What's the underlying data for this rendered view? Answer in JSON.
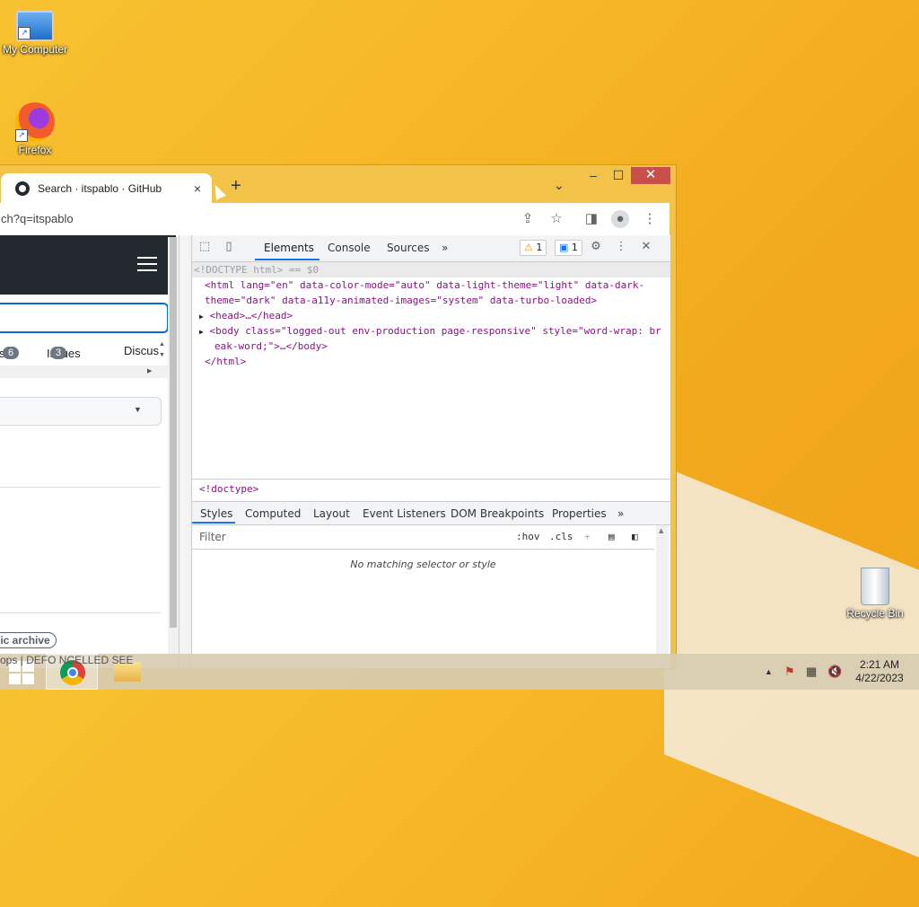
{
  "desktop": {
    "icons": [
      {
        "label": "My Computer",
        "icon": "computer-icon"
      },
      {
        "label": "Firefox",
        "icon": "firefox-icon"
      },
      {
        "label": "Recycle Bin",
        "icon": "recycle-bin-icon"
      }
    ]
  },
  "browser": {
    "tab": {
      "title": "Search · itspablo · GitHub",
      "close": "×"
    },
    "new_tab": "+",
    "tab_list": "⌄",
    "window_controls": {
      "minimize": "–",
      "maximize": "☐",
      "close": "✕"
    },
    "address": "ch?q=itspablo",
    "toolbar_icons": [
      "share-icon",
      "star-icon",
      "side-panel-icon",
      "profile-icon",
      "menu-icon"
    ]
  },
  "page": {
    "nav": [
      {
        "label": "s",
        "count": "6"
      },
      {
        "label": "Issues",
        "count": "3"
      },
      {
        "label": "Discus",
        "count": ""
      }
    ],
    "dot": ".",
    "archive_label": "lic archive",
    "bottom_text": "ops | DEFO    NCELLED  SEE"
  },
  "devtools": {
    "tabs": [
      "Elements",
      "Console",
      "Sources"
    ],
    "more": "»",
    "warnings": "1",
    "messages": "1",
    "dom": {
      "doctype": "<!DOCTYPE html> == $0",
      "html_open_1": "<html lang=\"en\" data-color-mode=\"auto\" data-light-theme=\"light\" data-dark-",
      "html_open_2": "theme=\"dark\" data-a11y-animated-images=\"system\" data-turbo-loaded>",
      "head": "<head>…</head>",
      "body_1": "<body class=\"logged-out env-production page-responsive\" style=\"word-wrap: br",
      "body_2": "eak-word;\">…</body>",
      "html_close": "</html>"
    },
    "breadcrumb": "<!doctype>",
    "subtabs": [
      "Styles",
      "Computed",
      "Layout",
      "Event Listeners",
      "DOM Breakpoints",
      "Properties"
    ],
    "filter_placeholder": "Filter",
    "hov": ":hov",
    "cls": ".cls",
    "no_match": "No matching selector or style"
  },
  "taskbar": {
    "time": "2:21 AM",
    "date": "4/22/2023"
  }
}
